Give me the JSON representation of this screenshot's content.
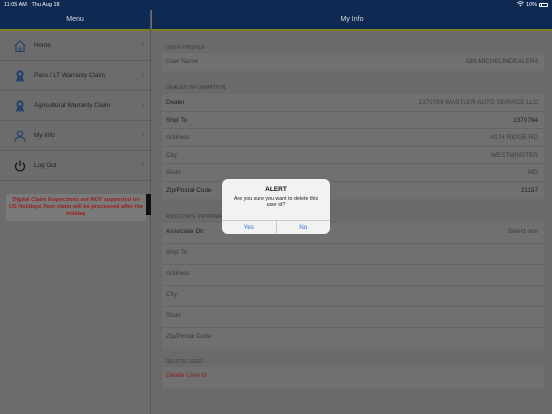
{
  "status_bar": {
    "time": "11:05 AM",
    "date": "Thu Aug 18",
    "battery": "10%",
    "wifi_icon": "wifi-icon"
  },
  "sidebar": {
    "title": "Menu",
    "items": [
      {
        "label": "Home",
        "icon": "home-icon"
      },
      {
        "label": "Pass / LT Warranty Claim",
        "icon": "warranty-ribbon-icon"
      },
      {
        "label": "Agricultural Warranty Claim",
        "icon": "warranty-ribbon-icon"
      },
      {
        "label": "My Info",
        "icon": "user-icon"
      },
      {
        "label": "Log Out",
        "icon": "power-icon"
      }
    ],
    "notice": "Digital Claim Inspections are NOT supported on US Holidays.Your claim will be processed after the holiday"
  },
  "main": {
    "title": "My Info",
    "user_profile": {
      "section": "USER PROFILE",
      "user_name_label": "User Name",
      "user_name_value": "OM-MICHELINDEALER4"
    },
    "dealer_info": {
      "section": "DEALER INFORMATION",
      "rows": [
        {
          "label": "Dealer",
          "value": "1370784 WASTLER AUTO SERVICE LLC"
        },
        {
          "label": "Ship To",
          "value": "1370784"
        },
        {
          "label": "Address",
          "value": "4174 RIDGE RD"
        },
        {
          "label": "City",
          "value": "WESTMINSTER"
        },
        {
          "label": "State",
          "value": "MD"
        },
        {
          "label": "Zip/Postal Code",
          "value": "21157"
        }
      ]
    },
    "associate_info": {
      "section": "ASSOCIATE INFORMAT",
      "associate_label": "Associate Dlr",
      "associate_placeholder": "Select one",
      "rows": [
        "Ship To",
        "Address",
        "City",
        "State",
        "Zip/Postal Code"
      ]
    },
    "delete_user": {
      "section": "DELETE USER",
      "label": "Delete User Id"
    }
  },
  "alert": {
    "title": "ALERT",
    "message": "Are you sure you want to delete this user id?",
    "yes": "Yes",
    "no": "No"
  }
}
